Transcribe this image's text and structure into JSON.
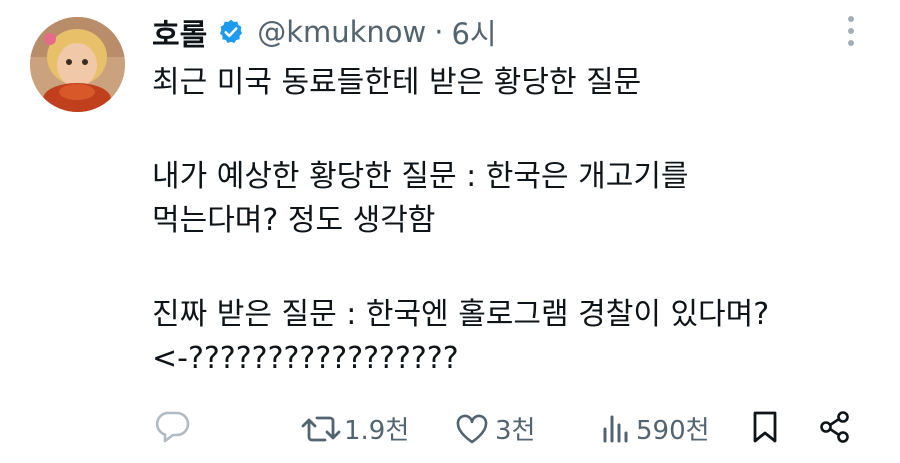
{
  "user": {
    "name": "호롤",
    "handle": "@kmuknow",
    "separator": "·",
    "time": "6시"
  },
  "tweet": {
    "lines": [
      "최근 미국 동료들한테 받은 황당한 질문",
      "내가 예상한 황당한 질문 : 한국은 개고기를",
      "먹는다며? 정도 생각함",
      "진짜 받은 질문 : 한국엔 홀로그램 경찰이 있다며?",
      "<-?????????????????"
    ]
  },
  "actions": {
    "reply_count": "",
    "retweet_count": "1.9천",
    "like_count": "3천",
    "view_count": "590천"
  },
  "colors": {
    "verified": "#1d9bf0",
    "secondary_text": "#536471",
    "primary_text": "#0f1419"
  }
}
